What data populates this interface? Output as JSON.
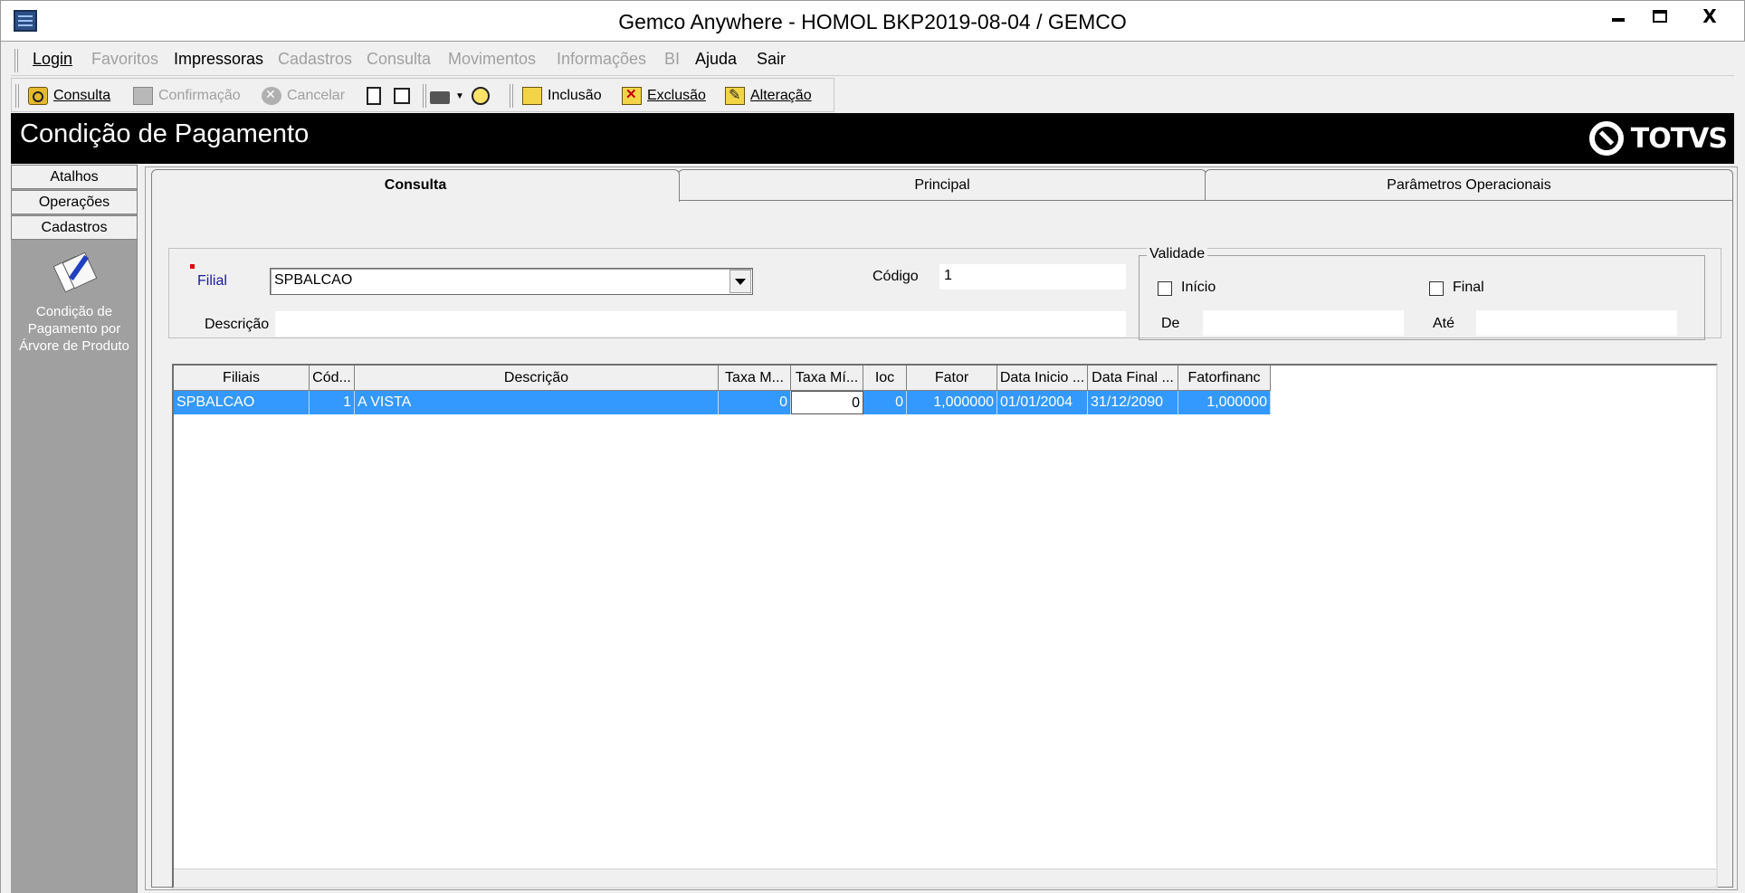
{
  "window": {
    "title": "Gemco Anywhere - HOMOL BKP2019-08-04 / GEMCO",
    "minimize_label": "",
    "close_label": "X"
  },
  "menu": [
    {
      "label": "Login",
      "enabled": true
    },
    {
      "label": "Favoritos",
      "enabled": false
    },
    {
      "label": "Impressoras",
      "enabled": true
    },
    {
      "label": "Cadastros",
      "enabled": false
    },
    {
      "label": "Consulta",
      "enabled": false
    },
    {
      "label": "Movimentos",
      "enabled": false
    },
    {
      "label": "Informações",
      "enabled": false
    },
    {
      "label": "BI",
      "enabled": false
    },
    {
      "label": "Ajuda",
      "enabled": true
    },
    {
      "label": "Sair",
      "enabled": true
    }
  ],
  "toolbar": {
    "consulta": "Consulta",
    "confirmacao": "Confirmação",
    "cancelar": "Cancelar",
    "inclusao": "Inclusão",
    "exclusao": "Exclusão",
    "alteracao": "Alteração"
  },
  "header": {
    "title": "Condição de Pagamento",
    "logo": "TOTVS"
  },
  "leftnav": {
    "buttons": [
      "Atalhos",
      "Operações",
      "Cadastros"
    ],
    "item_label": "Condição de Pagamento por Árvore de Produto"
  },
  "tabs": [
    {
      "label": "Consulta",
      "active": true
    },
    {
      "label": "Principal",
      "active": false
    },
    {
      "label": "Parâmetros Operacionais",
      "active": false
    }
  ],
  "form": {
    "filial_label": "Filial",
    "filial_value": "SPBALCAO",
    "codigo_label": "Código",
    "codigo_value": "1",
    "descricao_label": "Descrição",
    "descricao_value": "",
    "validade_label": "Validade",
    "inicio_label": "Início",
    "inicio_checked": false,
    "final_label": "Final",
    "final_checked": false,
    "de_label": "De",
    "de_value": "",
    "ate_label": "Até",
    "ate_value": ""
  },
  "grid": {
    "columns": [
      "Filiais",
      "Cód...",
      "Descrição",
      "Taxa M...",
      "Taxa Mí...",
      "Ioc",
      "Fator",
      "Data Inicio ...",
      "Data Final ...",
      "Fatorfinanc"
    ],
    "rows": [
      [
        "SPBALCAO",
        "1",
        "A VISTA",
        "0",
        "0",
        "0",
        "1,000000",
        "01/01/2004",
        "31/12/2090",
        "1,000000"
      ]
    ]
  },
  "colors": {
    "selection": "#3399ff",
    "header_bg": "#000000",
    "leftnav_bg": "#a0a0a0",
    "required_marker": "#e00000"
  }
}
